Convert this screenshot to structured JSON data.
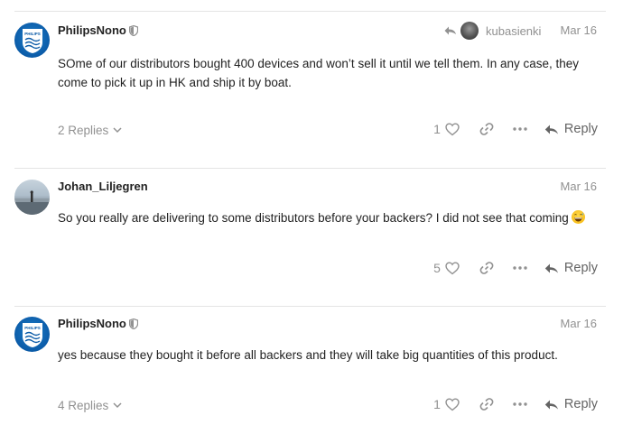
{
  "posts": [
    {
      "username": "PhilipsNono",
      "avatar_text": "PHILIPS",
      "reply_to": "kubasienki",
      "date": "Mar 16",
      "body": "SOme of our distributors bought 400 devices and won’t sell it until we tell them. In any case, they come to pick it up in HK and ship it by boat.",
      "replies_label": "2 Replies",
      "likes": "1",
      "reply_label": "Reply"
    },
    {
      "username": "Johan_Liljegren",
      "date": "Mar 16",
      "body": "So you really are delivering to some distributors before your backers? I did not see that coming",
      "likes": "5",
      "reply_label": "Reply"
    },
    {
      "username": "PhilipsNono",
      "avatar_text": "PHILIPS",
      "date": "Mar 16",
      "body": "yes because they bought it before all backers and they will take big quantities of this product.",
      "replies_label": "4 Replies",
      "likes": "1",
      "reply_label": "Reply"
    }
  ],
  "icons": {
    "shield": "shield-icon",
    "reply_arrow": "reply-arrow-icon",
    "heart": "heart-icon",
    "link": "link-icon",
    "more": "more-icon",
    "chevron": "chevron-down-icon",
    "emoji": "grinning-sweat-emoji-icon"
  },
  "colors": {
    "muted": "#919191",
    "text": "#222222",
    "philips_blue": "#0b5ba8"
  }
}
